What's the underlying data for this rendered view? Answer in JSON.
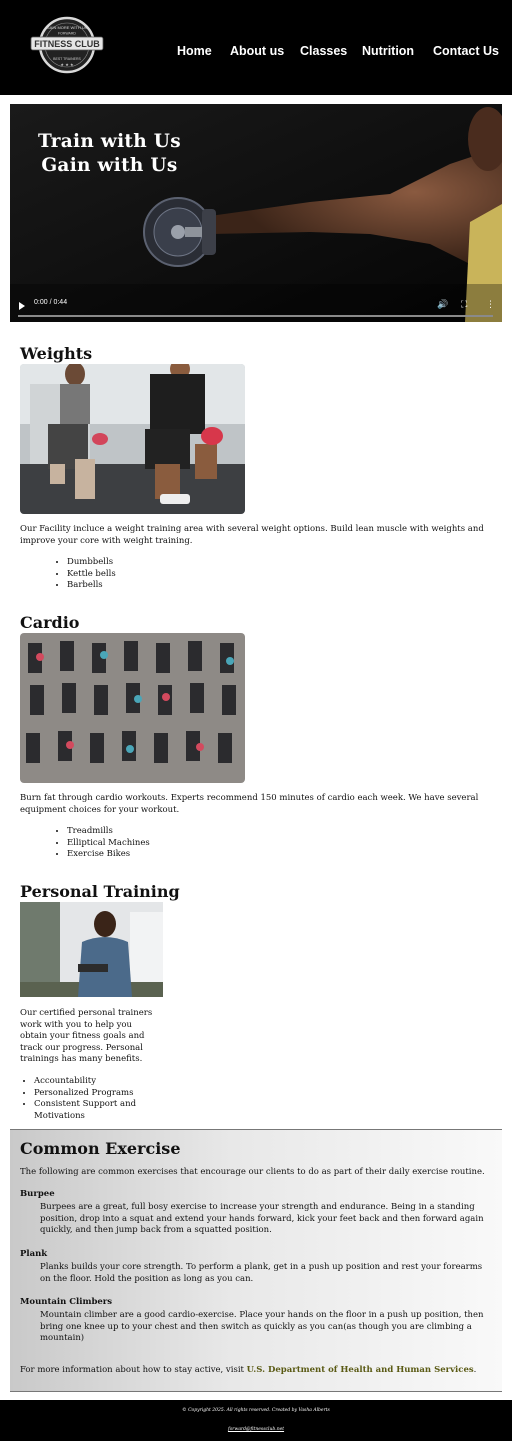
{
  "header": {
    "logo": {
      "top_text": "GAIN MORE WITH US",
      "main_text": "FITNESS CLUB",
      "sub_text": "FORWARD",
      "bottom_text": "BEST TRAINERS"
    },
    "nav": [
      "Home",
      "About us",
      "Classes",
      "Nutrition",
      "Contact Us"
    ]
  },
  "video": {
    "title_line1": "Train with Us",
    "title_line2": "Gain with Us",
    "time": "0:00 / 0:44"
  },
  "weights": {
    "title": "Weights",
    "description": "Our Facility incluce a weight training area with several weight options. Build lean muscle with weights and improve your core with weight training.",
    "items": [
      "Dumbbells",
      "Kettle bells",
      "Barbells"
    ]
  },
  "cardio": {
    "title": "Cardio",
    "description": "Burn fat through cardio workouts. Experts recommend 150 minutes of cardio each week. We have several equipment choices for your workout.",
    "items": [
      "Treadmills",
      "Elliptical Machines",
      "Exercise Bikes"
    ]
  },
  "personal": {
    "title": "Personal Training",
    "description": "Our certified personal trainers work with you to help you obtain your fitness goals and track our progress. Personal trainings has many benefits.",
    "items": [
      "Accountability",
      "Personalized Programs",
      "Consistent Support and Motivations"
    ]
  },
  "common": {
    "title": "Common Exercise",
    "intro": "The following are common exercises that encourage our clients to do as part of their daily exercise routine.",
    "exercises": [
      {
        "name": "Burpee",
        "text": "Burpees are a great, full bosy exercise to increase your strength and endurance. Being in a standing position, drop into a squat and extend your hands forward, kick your feet back and then forward again quickly, and then jump back from a squatted position."
      },
      {
        "name": "Plank",
        "text": "Planks builds your core strength. To perform a plank, get in a push up position and rest your forearms on the floor. Hold the position as long as you can."
      },
      {
        "name": "Mountain Climbers",
        "text": "Mountain climber are a good cardio-exercise. Place your hands on the floor in a push up position, then bring one knee up to your chest and then switch as quickly as you can(as though you are climbing a mountain)"
      }
    ],
    "more_prefix": "For more information about how to stay active, visit ",
    "more_link": "U.S. Department of Health and Human Services",
    "more_suffix": "."
  },
  "footer": {
    "copyright": "© Copyright 2025. All rights reserved. Created by Vasha Alberts",
    "email": "forward@fitnessclub.net"
  }
}
